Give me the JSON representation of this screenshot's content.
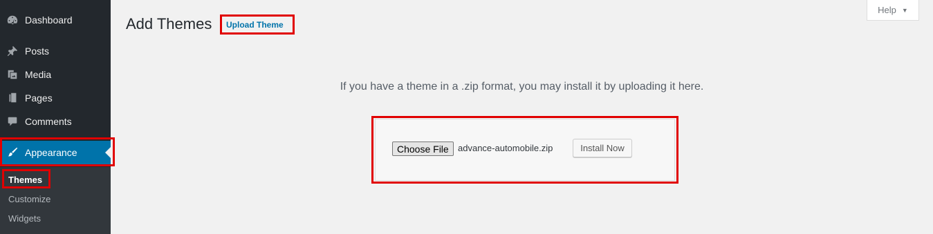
{
  "sidebar": {
    "items": [
      {
        "label": "Dashboard",
        "icon": "dashboard-icon"
      },
      {
        "label": "Posts",
        "icon": "pushpin-icon"
      },
      {
        "label": "Media",
        "icon": "media-icon"
      },
      {
        "label": "Pages",
        "icon": "pages-icon"
      },
      {
        "label": "Comments",
        "icon": "comment-icon"
      },
      {
        "label": "Appearance",
        "icon": "paintbrush-icon",
        "active": true
      }
    ],
    "submenu": [
      {
        "label": "Themes",
        "current": true
      },
      {
        "label": "Customize"
      },
      {
        "label": "Widgets"
      }
    ]
  },
  "header": {
    "title": "Add Themes",
    "upload_button": "Upload Theme",
    "help_label": "Help",
    "help_caret": "▼"
  },
  "upload": {
    "message": "If you have a theme in a .zip format, you may install it by uploading it here.",
    "choose_file_label": "Choose File",
    "file_name": "advance-automobile.zip",
    "install_label": "Install Now"
  },
  "colors": {
    "sidebar_bg": "#23282d",
    "active_bg": "#0073aa",
    "highlight": "#e10000",
    "page_bg": "#f1f1f1"
  }
}
